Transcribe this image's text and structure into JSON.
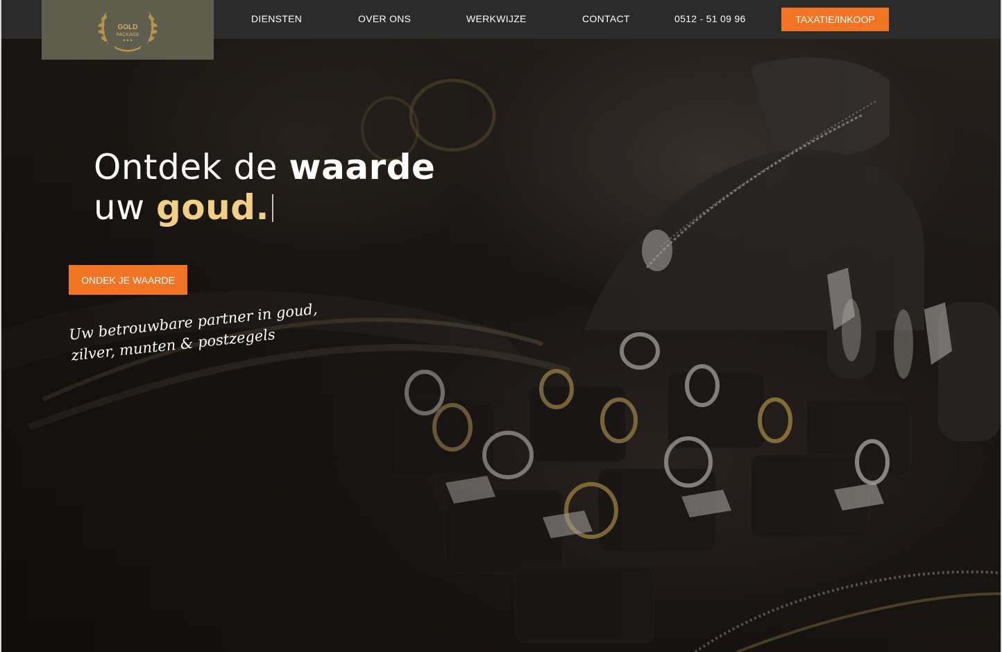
{
  "logo": {
    "line1": "GOLD",
    "line2": "PACKAGE"
  },
  "nav": {
    "items": [
      {
        "label": "DIENSTEN"
      },
      {
        "label": "OVER ONS"
      },
      {
        "label": "WERKWIJZE"
      },
      {
        "label": "CONTACT"
      }
    ],
    "phone": "0512 - 51 09 96",
    "cta_label": "TAXATIE/INKOOP"
  },
  "hero": {
    "headline_part1": "Ontdek de",
    "headline_part2": "waarde",
    "headline_part3": "uw",
    "headline_part4": "goud.",
    "cta_label": "ONDEK JE WAARDE",
    "tagline": "Uw betrouwbare partner in goud, zilver, munten & postzegels"
  },
  "colors": {
    "accent": "#f07424",
    "gold_text": "#f1cf86",
    "topbar": "#2b2b2b",
    "logo_bg": "#5e5e4e"
  }
}
